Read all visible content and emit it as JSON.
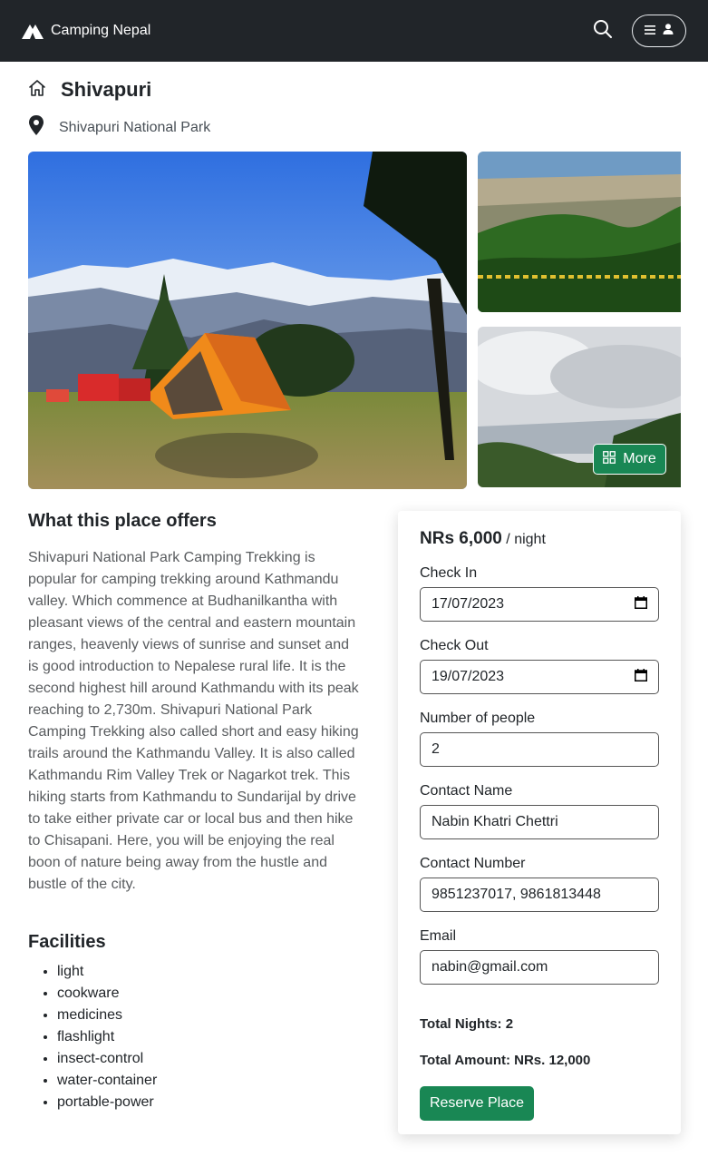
{
  "navbar": {
    "brand_name": "Camping Nepal",
    "brand_icon": "tent-logo-icon",
    "search_icon": "search-icon",
    "menu_icon": "hamburger-icon",
    "user_icon": "user-icon"
  },
  "place": {
    "title": "Shivapuri",
    "title_icon": "home-icon",
    "location": "Shivapuri National Park",
    "location_icon": "map-pin-icon"
  },
  "gallery": {
    "more_label": "More",
    "more_icon": "grid-icon"
  },
  "offers": {
    "heading": "What this place offers",
    "description": "Shivapuri National Park Camping Trekking is popular for camping trekking around Kathmandu valley. Which commence at Budhanilkantha with pleasant views of the central and eastern mountain ranges, heavenly views of sunrise and sunset and is good introduction to Nepalese rural life. It is the second highest hill around Kathmandu with its peak reaching to 2,730m. Shivapuri National Park Camping Trekking also called short and easy hiking trails around the Kathmandu Valley. It is also called Kathmandu Rim Valley Trek or Nagarkot trek. This hiking starts from Kathmandu to Sundarijal by drive to take either private car or local bus and then hike to Chisapani. Here, you will be enjoying the real boon of nature being away from the hustle and bustle of the city."
  },
  "facilities": {
    "heading": "Facilities",
    "items": [
      "light",
      "cookware",
      "medicines",
      "flashlight",
      "insect-control",
      "water-container",
      "portable-power"
    ]
  },
  "booking": {
    "price": "NRs 6,000",
    "per_night": "/ night",
    "check_in_label": "Check In",
    "check_in_value": "17/07/2023",
    "check_out_label": "Check Out",
    "check_out_value": "19/07/2023",
    "people_label": "Number of people",
    "people_value": "2",
    "contact_name_label": "Contact Name",
    "contact_name_value": "Nabin Khatri Chettri",
    "contact_number_label": "Contact Number",
    "contact_number_value": "9851237017, 9861813448",
    "email_label": "Email",
    "email_value": "nabin@gmail.com",
    "total_nights": "Total Nights: 2",
    "total_amount": "Total Amount: NRs. 12,000",
    "reserve_label": "Reserve Place"
  },
  "colors": {
    "navbar_bg": "#212529",
    "accent_green": "#198754"
  }
}
